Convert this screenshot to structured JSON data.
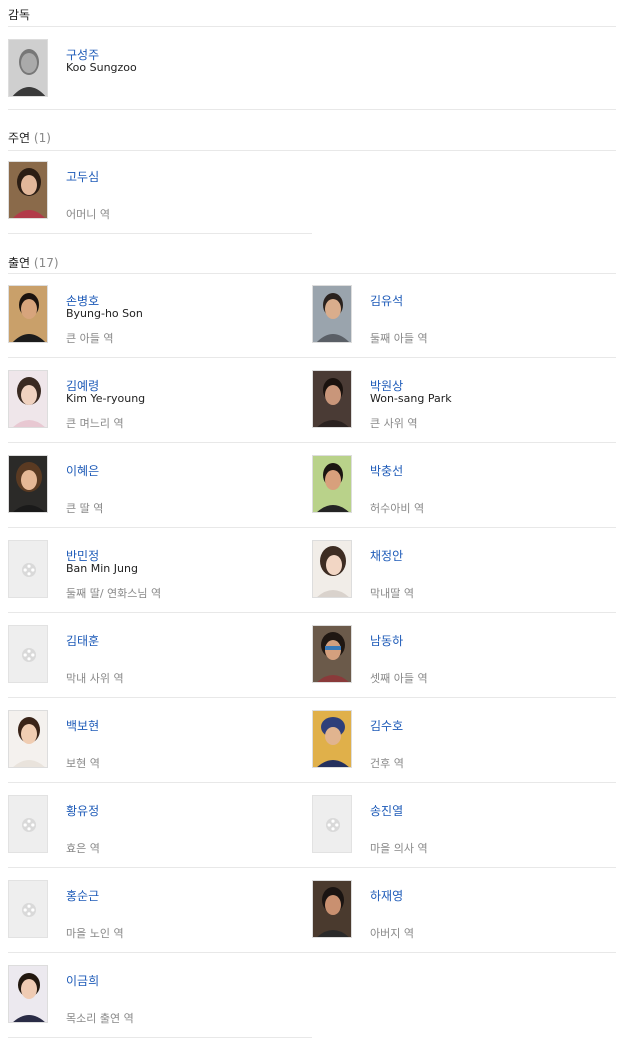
{
  "sections": {
    "director": {
      "label": "감독",
      "count": ""
    },
    "lead": {
      "label": "주연",
      "count": "(1)"
    },
    "cast": {
      "label": "출연",
      "count": "(17)"
    }
  },
  "director": {
    "name": "구성주",
    "eng": "Koo Sungzoo",
    "photo": "gray-portrait"
  },
  "lead": [
    {
      "name": "고두심",
      "eng": "",
      "role": "어머니 역",
      "photo": "portrait"
    }
  ],
  "cast": [
    {
      "name": "손병호",
      "eng": "Byung-ho Son",
      "role": "큰 아들 역",
      "photo": "portrait"
    },
    {
      "name": "김유석",
      "eng": "",
      "role": "둘째 아들 역",
      "photo": "portrait"
    },
    {
      "name": "김예령",
      "eng": "Kim Ye-ryoung",
      "role": "큰 며느리 역",
      "photo": "portrait"
    },
    {
      "name": "박원상",
      "eng": "Won-sang Park",
      "role": "큰 사위 역",
      "photo": "portrait"
    },
    {
      "name": "이혜은",
      "eng": "",
      "role": "큰 딸 역",
      "photo": "portrait"
    },
    {
      "name": "박충선",
      "eng": "",
      "role": "허수아비 역",
      "photo": "portrait"
    },
    {
      "name": "반민정",
      "eng": "Ban Min Jung",
      "role": "둘째 딸/ 연화스님 역",
      "photo": "film-reel-placeholder"
    },
    {
      "name": "채정안",
      "eng": "",
      "role": "막내딸 역",
      "photo": "portrait"
    },
    {
      "name": "김태훈",
      "eng": "",
      "role": "막내 사위 역",
      "photo": "film-reel-placeholder"
    },
    {
      "name": "남동하",
      "eng": "",
      "role": "셋째 아들 역",
      "photo": "portrait"
    },
    {
      "name": "백보현",
      "eng": "",
      "role": "보현 역",
      "photo": "portrait"
    },
    {
      "name": "김수호",
      "eng": "",
      "role": "건후 역",
      "photo": "portrait"
    },
    {
      "name": "황유정",
      "eng": "",
      "role": "효은 역",
      "photo": "film-reel-placeholder"
    },
    {
      "name": "송진열",
      "eng": "",
      "role": "마을 의사 역",
      "photo": "film-reel-placeholder"
    },
    {
      "name": "홍순근",
      "eng": "",
      "role": "마을 노인 역",
      "photo": "film-reel-placeholder"
    },
    {
      "name": "하재영",
      "eng": "",
      "role": "아버지 역",
      "photo": "portrait"
    },
    {
      "name": "이금희",
      "eng": "",
      "role": "목소리 출연 역",
      "photo": "portrait"
    }
  ]
}
